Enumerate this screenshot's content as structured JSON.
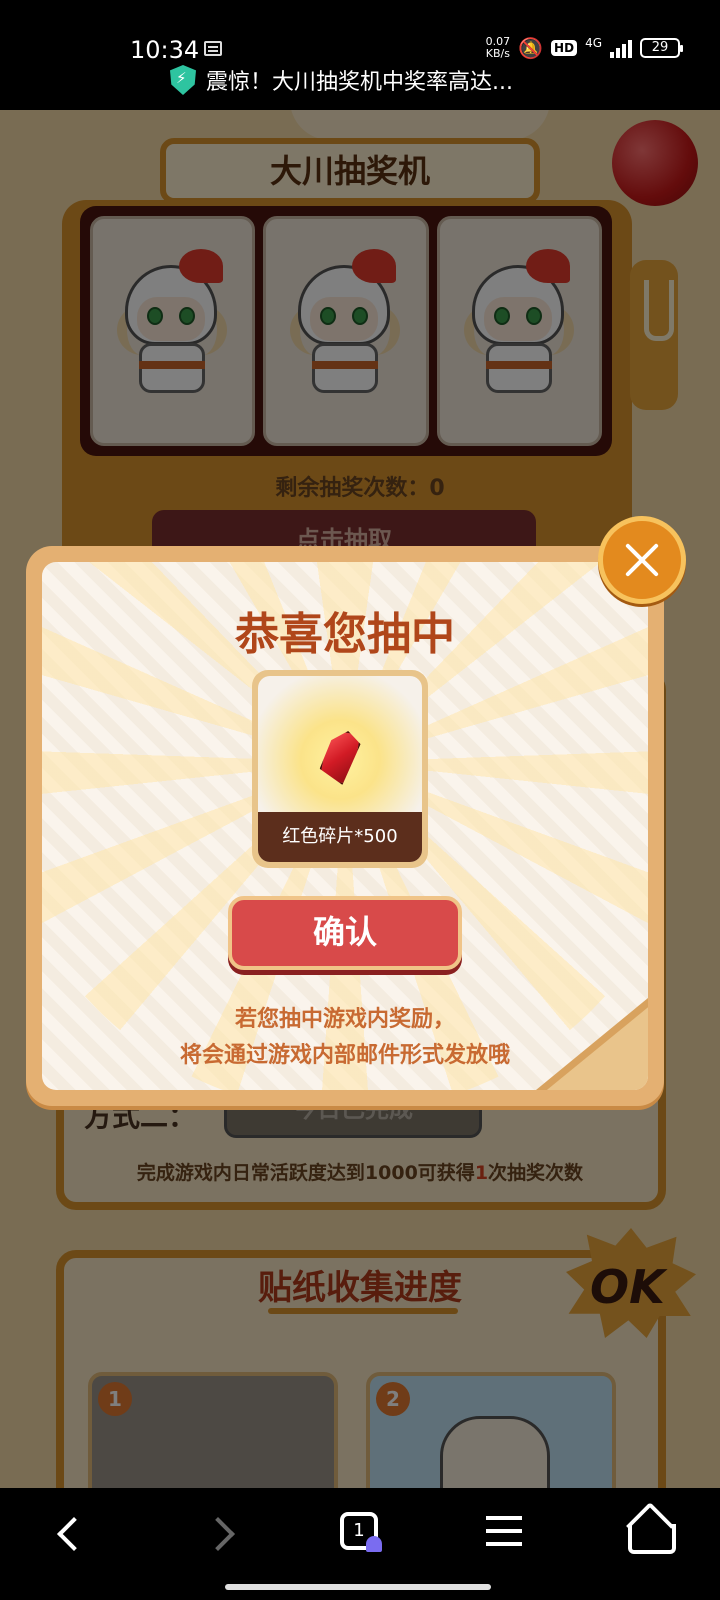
{
  "status_bar": {
    "time": "10:34",
    "net_speed_value": "0.07",
    "net_speed_unit": "KB/s",
    "hd_badge": "HD",
    "network": "4G",
    "battery": "29",
    "ticker_text": "震惊！大川抽奖机中奖率高达..."
  },
  "machine": {
    "title": "大川抽奖机",
    "remaining_label": "剩余抽奖次数：",
    "remaining_count": "0",
    "draw_button": "点击抽取"
  },
  "tasks": {
    "method2_label": "方式二：",
    "method2_status": "今日已完成",
    "method2_desc_prefix": "完成游戏内日常活跃度达到1000可获得",
    "method2_desc_highlight": "1",
    "method2_desc_suffix": "次抽奖次数"
  },
  "stickers": {
    "title": "贴纸收集进度",
    "ok_badge": "OK",
    "items": [
      {
        "number": "1"
      },
      {
        "number": "2"
      }
    ]
  },
  "modal": {
    "title": "恭喜您抽中",
    "prize_label": "红色碎片*500",
    "confirm_button": "确认",
    "note_line1": "若您抽中游戏内奖励，",
    "note_line2": "将会通过游戏内部邮件形式发放哦"
  },
  "nav": {
    "tab_count": "1"
  },
  "icons": {
    "close": "close-icon",
    "gem": "gem-icon",
    "shield": "shield-icon"
  },
  "colors": {
    "modal_title": "#b0461a",
    "confirm_button": "#d84a4a",
    "close_button": "#e38a1e"
  }
}
